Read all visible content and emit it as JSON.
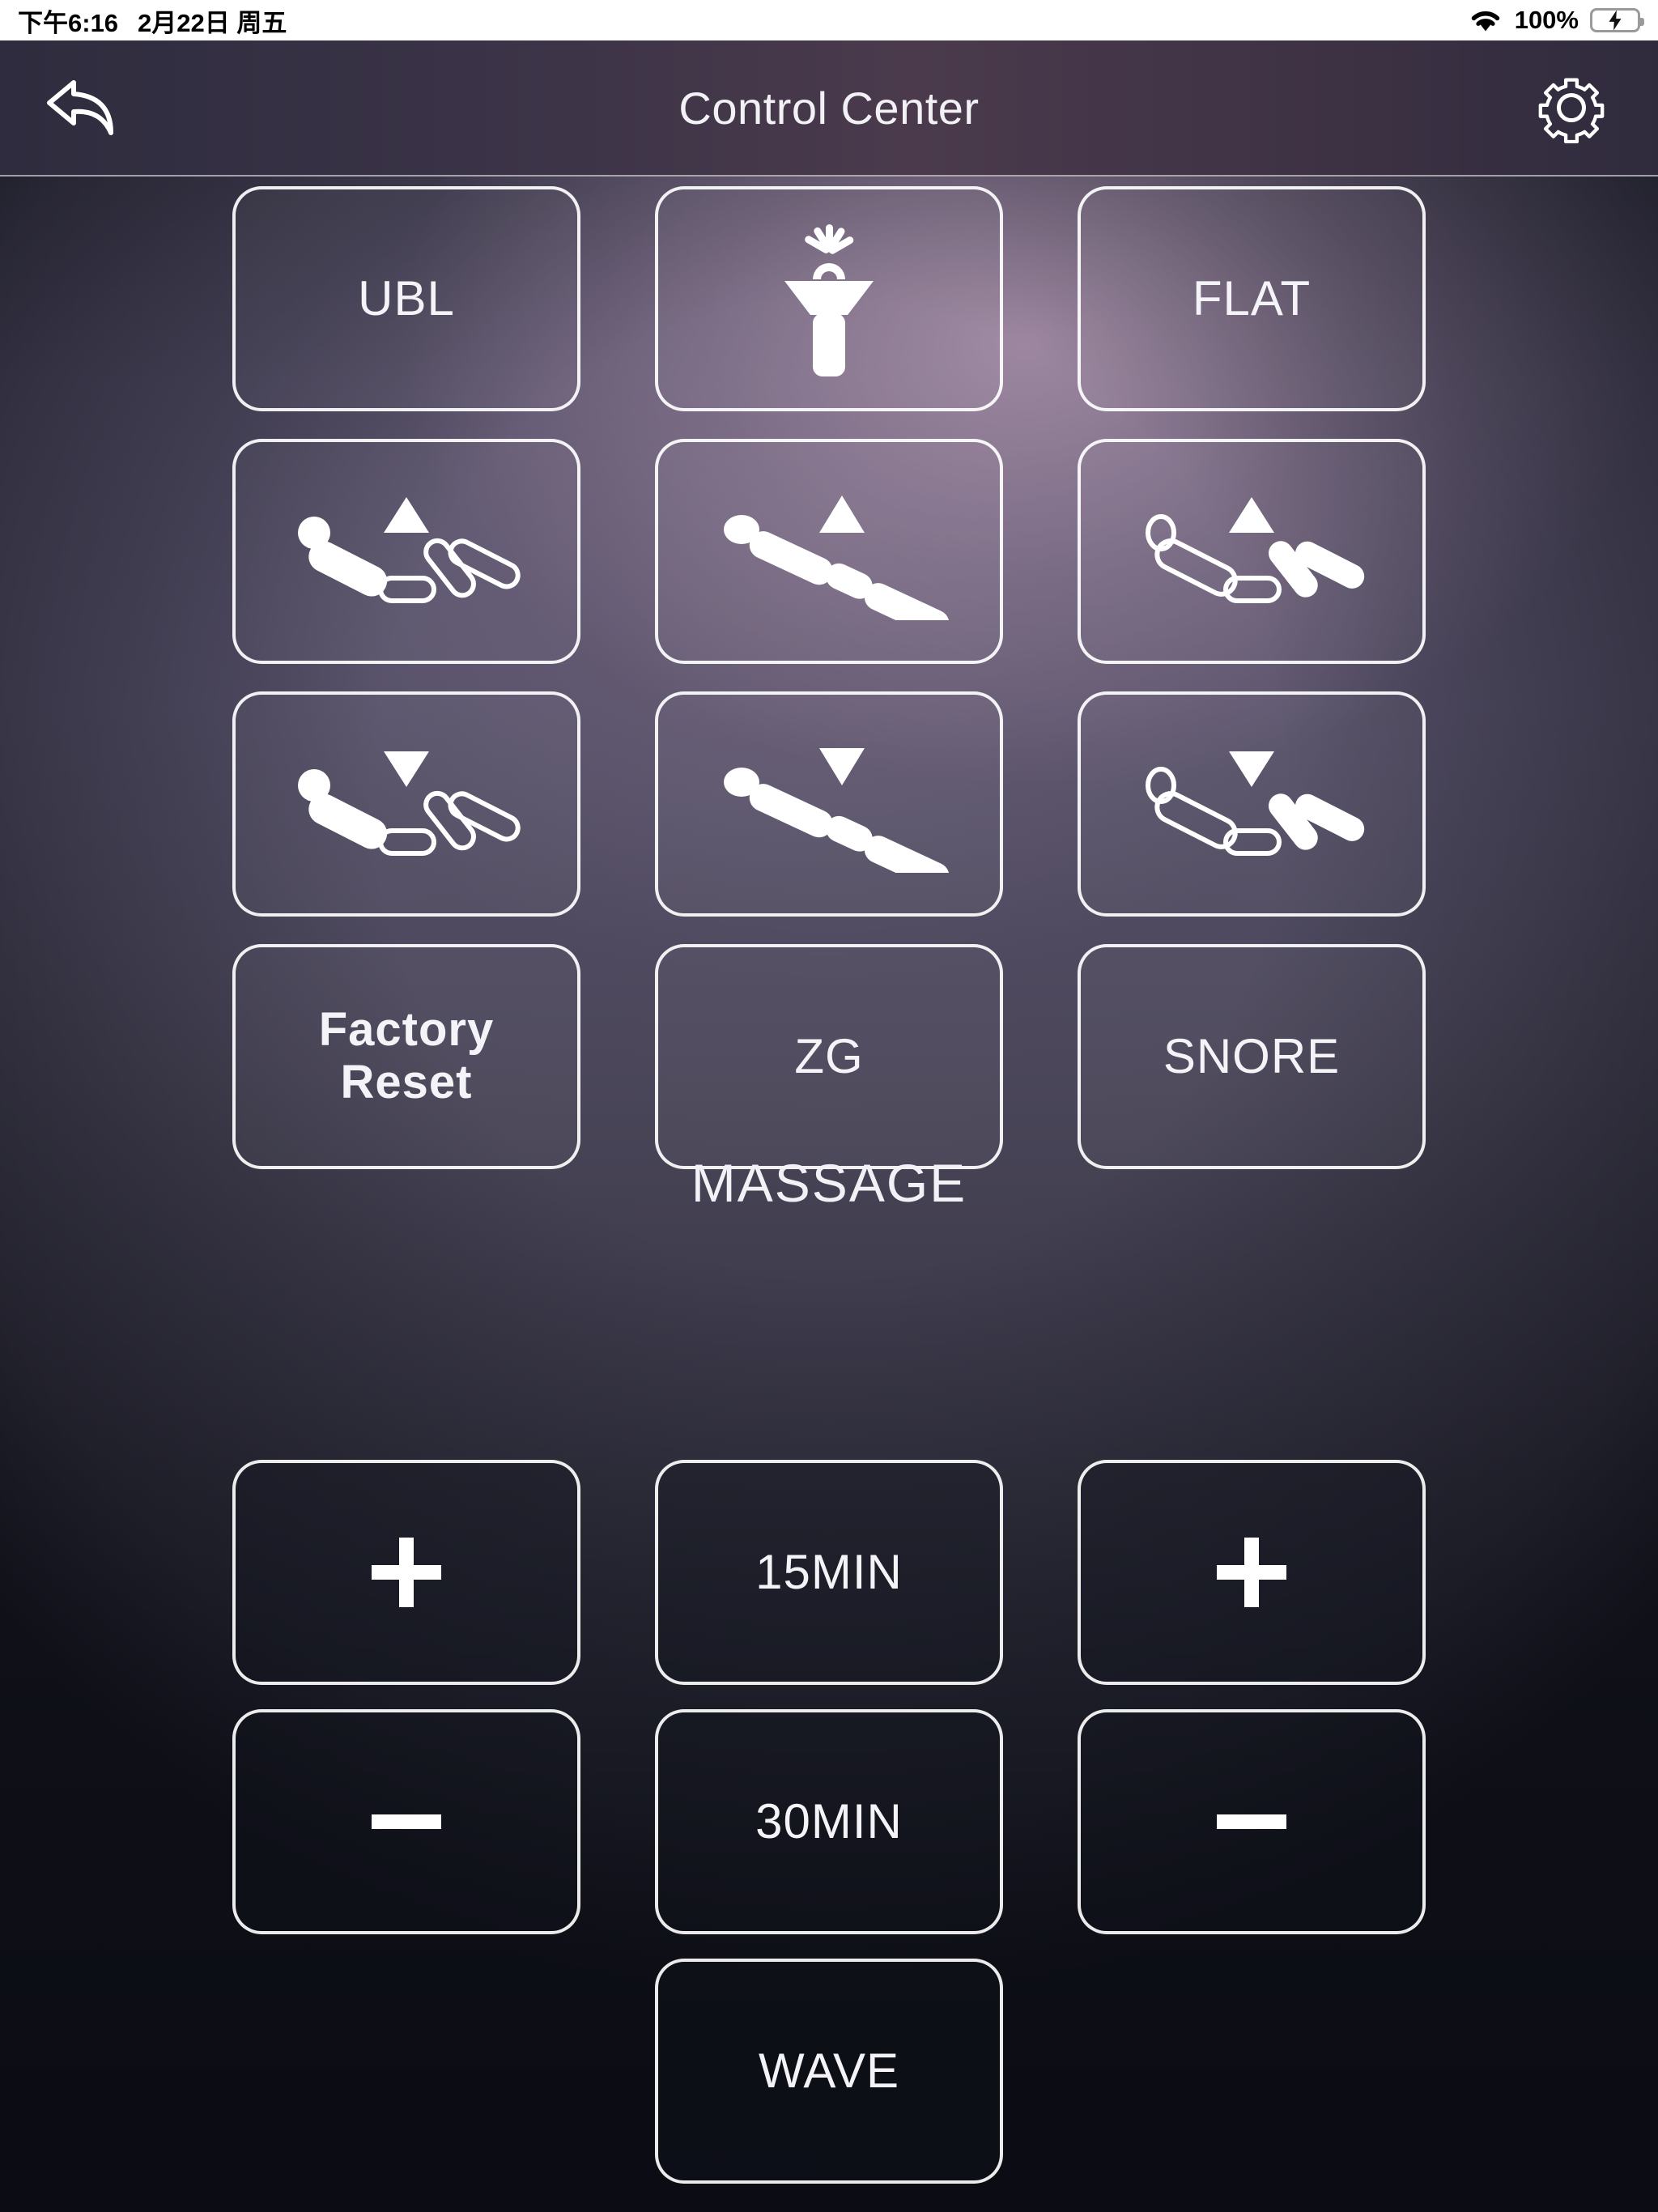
{
  "status_bar": {
    "time": "下午6:16",
    "date": "2月22日 周五",
    "battery_percent": "100%",
    "wifi_icon": "wifi-icon",
    "battery_icon": "battery-charging-icon"
  },
  "nav": {
    "title": "Control Center",
    "back_icon": "back-arrow-icon",
    "settings_icon": "gear-icon"
  },
  "controls": {
    "buttons": [
      {
        "id": "ubl",
        "label": "UBL",
        "type": "text"
      },
      {
        "id": "flashlight",
        "label": "",
        "type": "icon",
        "icon": "flashlight-icon"
      },
      {
        "id": "flat",
        "label": "FLAT",
        "type": "text"
      },
      {
        "id": "head-up",
        "label": "",
        "type": "icon",
        "icon": "bed-head-up-icon"
      },
      {
        "id": "bed-up",
        "label": "",
        "type": "icon",
        "icon": "bed-tilt-up-icon"
      },
      {
        "id": "foot-up",
        "label": "",
        "type": "icon",
        "icon": "bed-foot-up-icon"
      },
      {
        "id": "head-down",
        "label": "",
        "type": "icon",
        "icon": "bed-head-down-icon"
      },
      {
        "id": "bed-down",
        "label": "",
        "type": "icon",
        "icon": "bed-tilt-down-icon"
      },
      {
        "id": "foot-down",
        "label": "",
        "type": "icon",
        "icon": "bed-foot-down-icon"
      },
      {
        "id": "factory-reset",
        "label": "Factory\nReset",
        "type": "text",
        "bold": true
      },
      {
        "id": "zg",
        "label": "ZG",
        "type": "text"
      },
      {
        "id": "snore",
        "label": "SNORE",
        "type": "text"
      }
    ]
  },
  "massage": {
    "heading": "MASSAGE",
    "buttons": [
      {
        "id": "head-massage-up",
        "label": "",
        "type": "icon",
        "icon": "plus-icon"
      },
      {
        "id": "timer-15",
        "label": "15MIN",
        "type": "text"
      },
      {
        "id": "foot-massage-up",
        "label": "",
        "type": "icon",
        "icon": "plus-icon"
      },
      {
        "id": "head-massage-down",
        "label": "",
        "type": "icon",
        "icon": "minus-icon"
      },
      {
        "id": "timer-30",
        "label": "30MIN",
        "type": "text"
      },
      {
        "id": "foot-massage-down",
        "label": "",
        "type": "icon",
        "icon": "minus-icon"
      },
      {
        "id": "wave",
        "label": "WAVE",
        "type": "text"
      }
    ]
  },
  "colors": {
    "accent_glow": "#7e6e89",
    "background_dark": "#14151f",
    "border_white": "#ffffff",
    "battery_green": "#3ad35a"
  }
}
